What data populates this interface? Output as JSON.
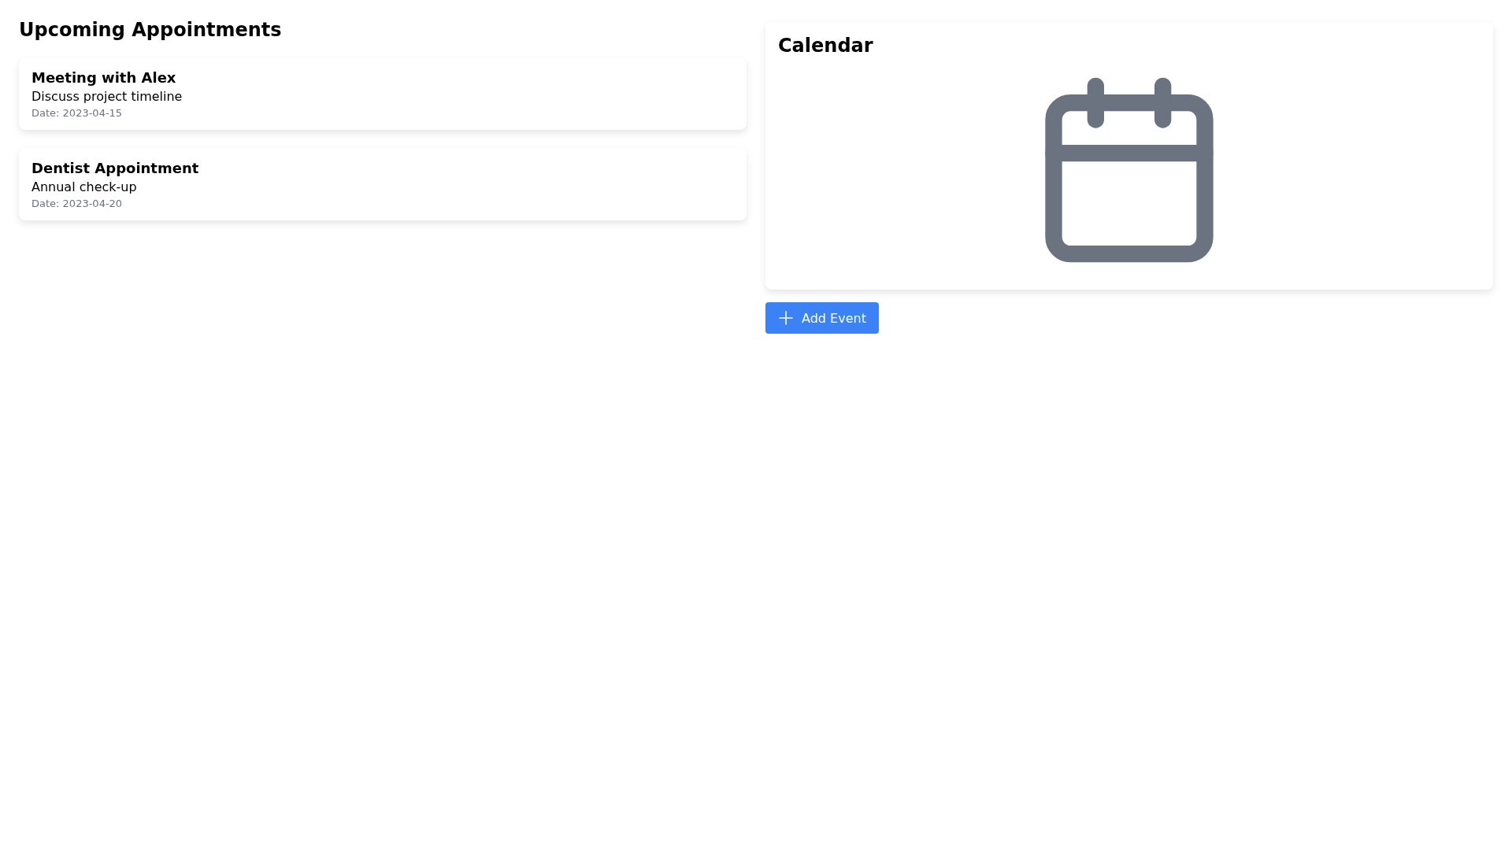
{
  "appointments_heading": "Upcoming Appointments",
  "appointments": [
    {
      "title": "Meeting with Alex",
      "description": "Discuss project timeline",
      "date": "Date: 2023-04-15"
    },
    {
      "title": "Dentist Appointment",
      "description": "Annual check-up",
      "date": "Date: 2023-04-20"
    }
  ],
  "calendar": {
    "title": "Calendar"
  },
  "add_button": {
    "label": "Add Event"
  }
}
